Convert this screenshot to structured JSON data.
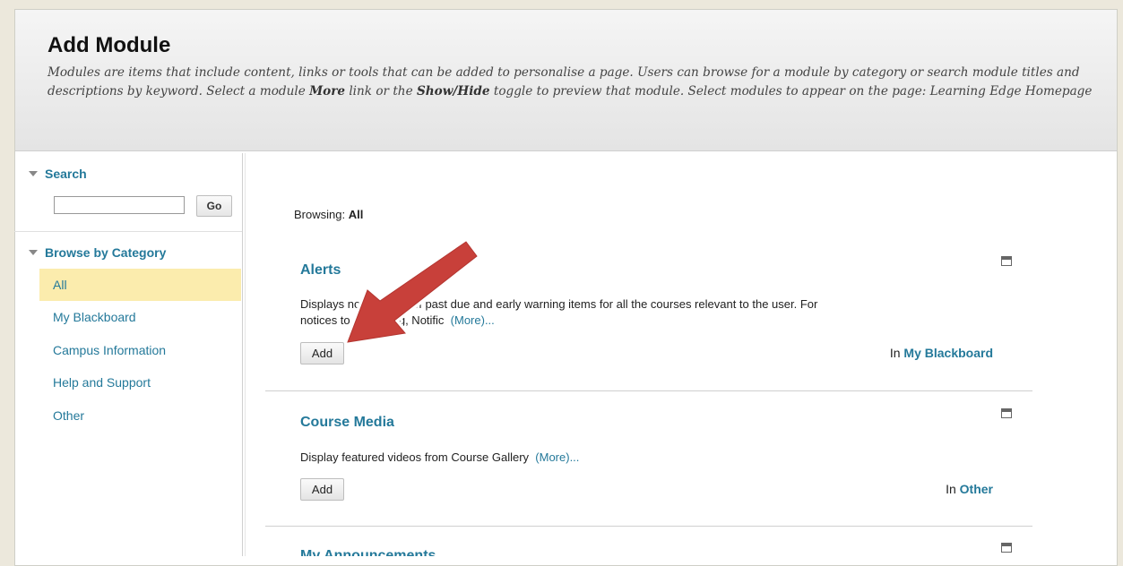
{
  "header": {
    "title": "Add Module",
    "instructions_1": "Modules are items that include content, links or tools that can be added to personalise a page. Users can browse for a module by category or search module titles and descriptions by keyword. Select a module ",
    "bold_more": "More",
    "instructions_2": " link or the ",
    "bold_showhide": "Show/Hide",
    "instructions_3": " toggle to preview that module. Select modules to appear on the page: Learning Edge Homepage"
  },
  "sidebar": {
    "search_label": "Search",
    "search_value": "",
    "go_label": "Go",
    "browse_label": "Browse by Category",
    "categories": [
      "All",
      "My Blackboard",
      "Campus Information",
      "Help and Support",
      "Other"
    ],
    "selected_category": "All"
  },
  "main": {
    "browsing_prefix": "Browsing: ",
    "browsing_value": "All",
    "modules": [
      {
        "title": "Alerts",
        "desc_line1": "Displays notifications of past due and early warning items for all the courses relevant to the user. For",
        "desc_line2": "notices to appearing, Notific",
        "more": "(More)...",
        "add_label": "Add",
        "in_prefix": "In ",
        "category": "My Blackboard"
      },
      {
        "title": "Course Media",
        "desc_line1": "Display featured videos from Course Gallery",
        "more": "(More)...",
        "add_label": "Add",
        "in_prefix": "In ",
        "category": "Other"
      },
      {
        "title": "My Announcements"
      }
    ]
  },
  "colors": {
    "link": "#24799a",
    "selected_bg": "#fbecad",
    "arrow": "#c8403a"
  }
}
